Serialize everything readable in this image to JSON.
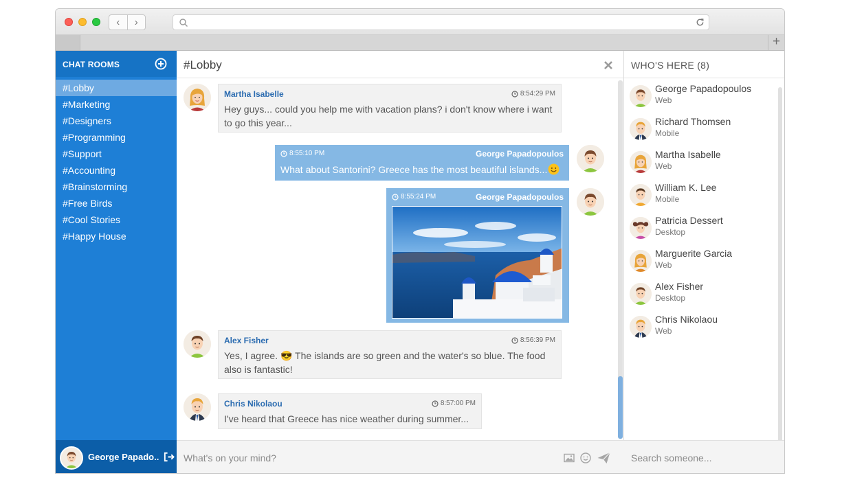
{
  "sidebar": {
    "title": "CHAT ROOMS",
    "rooms": [
      "#Lobby",
      "#Marketing",
      "#Designers",
      "#Programming",
      "#Support",
      "#Accounting",
      "#Brainstorming",
      "#Free Birds",
      "#Cool Stories",
      "#Happy House"
    ],
    "active_room": "#Lobby",
    "current_user": "George Papado..."
  },
  "chat": {
    "title": "#Lobby",
    "messages": [
      {
        "author": "Martha Isabelle",
        "time": "8:54:29 PM",
        "text": "Hey guys... could you help me with vacation plans? i don't know where i want to go this year...",
        "own": false
      },
      {
        "author": "George Papadopoulos",
        "time": "8:55:10 PM",
        "text": "What about Santorini? Greece has the most beautiful islands...",
        "own": true
      },
      {
        "author": "George Papadopoulos",
        "time": "8:55:24 PM",
        "text": "",
        "own": true,
        "attachment": "image"
      },
      {
        "author": "Alex Fisher",
        "time": "8:56:39 PM",
        "text": "Yes, I agree. 😎 The islands are so green and the water's so blue. The food also is fantastic!",
        "own": false
      },
      {
        "author": "Chris Nikolaou",
        "time": "8:57:00 PM",
        "text": "I've heard that Greece has nice weather during summer...",
        "own": false
      }
    ],
    "composer_placeholder": "What's on your mind?"
  },
  "people": {
    "title": "WHO'S HERE (8)",
    "list": [
      {
        "name": "George Papadopoulos",
        "device": "Web"
      },
      {
        "name": "Richard Thomsen",
        "device": "Mobile"
      },
      {
        "name": "Martha Isabelle",
        "device": "Web"
      },
      {
        "name": "William K. Lee",
        "device": "Mobile"
      },
      {
        "name": "Patricia Dessert",
        "device": "Desktop"
      },
      {
        "name": "Marguerite Garcia",
        "device": "Web"
      },
      {
        "name": "Alex Fisher",
        "device": "Desktop"
      },
      {
        "name": "Chris Nikolaou",
        "device": "Web"
      }
    ],
    "search_placeholder": "Search someone..."
  },
  "colors": {
    "sidebar": "#1e7fd6",
    "sidebar_header": "#1673c5",
    "sidebar_active": "#6eaae2",
    "own_bubble": "#85b8e4",
    "author_name": "#2a6bb0"
  }
}
